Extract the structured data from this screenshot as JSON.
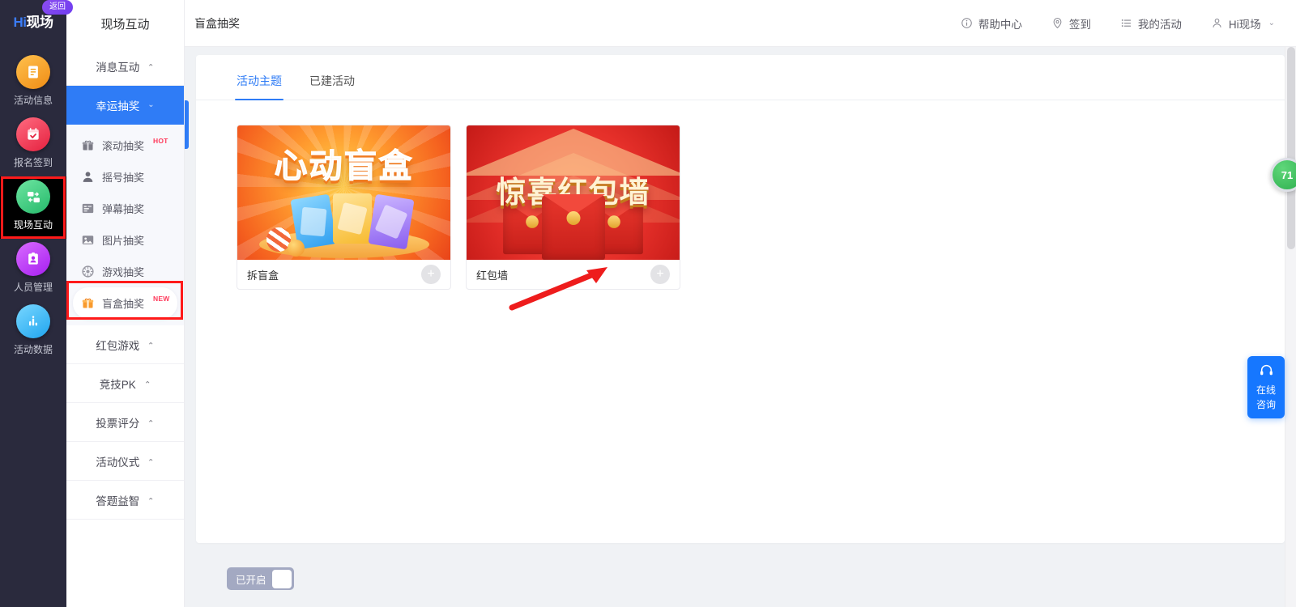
{
  "rail": {
    "logo_hi": "Hi",
    "logo_cn": "现场",
    "return_label": "返回",
    "items": [
      {
        "label": "活动信息",
        "icon": "document-icon",
        "color": "#f7a325",
        "active": false
      },
      {
        "label": "报名签到",
        "icon": "calendar-check-icon",
        "color": "#f2415a",
        "active": false
      },
      {
        "label": "现场互动",
        "icon": "interaction-exchange-icon",
        "color": "#3fd18a",
        "active": true
      },
      {
        "label": "人员管理",
        "icon": "id-card-icon",
        "color": "#c13df0",
        "active": false
      },
      {
        "label": "活动数据",
        "icon": "bar-chart-icon",
        "color": "#3fb6f5",
        "active": false
      }
    ]
  },
  "submenu": {
    "title": "现场互动",
    "groups": [
      {
        "label": "消息互动",
        "caret": "^",
        "active": false
      },
      {
        "label": "幸运抽奖",
        "caret": "v",
        "active": true
      }
    ],
    "lucky_draw_items": [
      {
        "label": "滚动抽奖",
        "icon": "gift-icon",
        "badge": "HOT",
        "highlight": false
      },
      {
        "label": "摇号抽奖",
        "icon": "person-icon",
        "badge": "",
        "highlight": false
      },
      {
        "label": "弹幕抽奖",
        "icon": "danmaku-list-icon",
        "badge": "",
        "highlight": false
      },
      {
        "label": "图片抽奖",
        "icon": "image-icon",
        "badge": "",
        "highlight": false
      },
      {
        "label": "游戏抽奖",
        "icon": "game-wheel-icon",
        "badge": "",
        "highlight": false
      },
      {
        "label": "盲盒抽奖",
        "icon": "blind-box-gift-icon",
        "badge": "NEW",
        "highlight": true
      }
    ],
    "tail_groups": [
      {
        "label": "红包游戏",
        "caret": "^"
      },
      {
        "label": "竞技PK",
        "caret": "^"
      },
      {
        "label": "投票评分",
        "caret": "^"
      },
      {
        "label": "活动仪式",
        "caret": "^"
      },
      {
        "label": "答题益智",
        "caret": "^"
      }
    ]
  },
  "topbar": {
    "breadcrumb": "盲盒抽奖",
    "links": [
      {
        "label": "帮助中心",
        "icon": "info-circle-icon"
      },
      {
        "label": "签到",
        "icon": "location-pin-icon"
      },
      {
        "label": "我的活动",
        "icon": "list-icon"
      },
      {
        "label": "Hi现场",
        "icon": "user-icon",
        "chevron": "⌄"
      }
    ]
  },
  "main": {
    "tabs": [
      {
        "label": "活动主题",
        "active": true
      },
      {
        "label": "已建活动",
        "active": false
      }
    ],
    "cards": [
      {
        "name": "拆盲盒",
        "art": "blind-box",
        "art_title": "心动盲盒",
        "add_label": "+"
      },
      {
        "name": "红包墙",
        "art": "red-packet",
        "art_title": "惊喜红包墙",
        "add_label": "+"
      }
    ]
  },
  "footer": {
    "toggle_label": "已开启",
    "toggle_on": true
  },
  "floating": {
    "coin_badge": "71",
    "chat_icon": "headset-icon",
    "chat_line1": "在线",
    "chat_line2": "咨询"
  },
  "colors": {
    "accent": "#2f7cf6",
    "rail_bg": "#2a2a3d",
    "highlight_box": "#ff1a1a",
    "arrow": "#ee1c1c"
  }
}
